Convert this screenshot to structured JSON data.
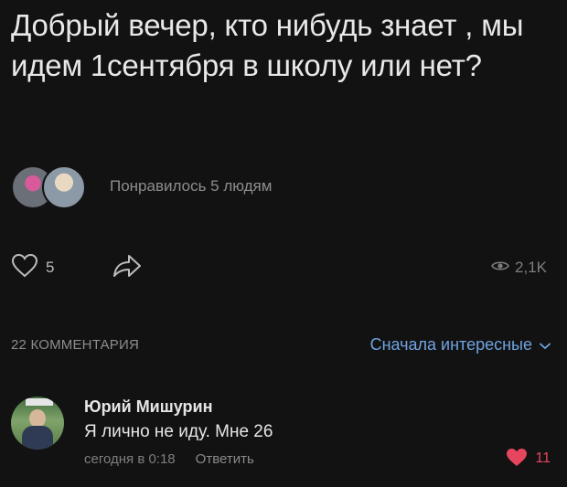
{
  "post": {
    "text": "Добрый вечер, кто нибудь знает , мы идем 1сентября в школу или нет?",
    "likes_text": "Понравилось 5 людям",
    "like_count": "5",
    "views": "2,1K"
  },
  "comments_section": {
    "count_label": "22 КОММЕНТАРИЯ",
    "sort_label": "Сначала интересные"
  },
  "comment": {
    "author": "Юрий Мишурин",
    "text": "Я лично не иду. Мне 26",
    "time": "сегодня в 0:18",
    "reply_label": "Ответить",
    "like_count": "11"
  },
  "icons": {
    "like": "heart-outline-icon",
    "share": "share-arrow-icon",
    "views": "eye-icon",
    "sort": "chevron-down-icon",
    "comment_like": "heart-filled-icon"
  },
  "colors": {
    "background": "#121212",
    "accent": "#6fa3e0",
    "like_red": "#e6455e"
  }
}
